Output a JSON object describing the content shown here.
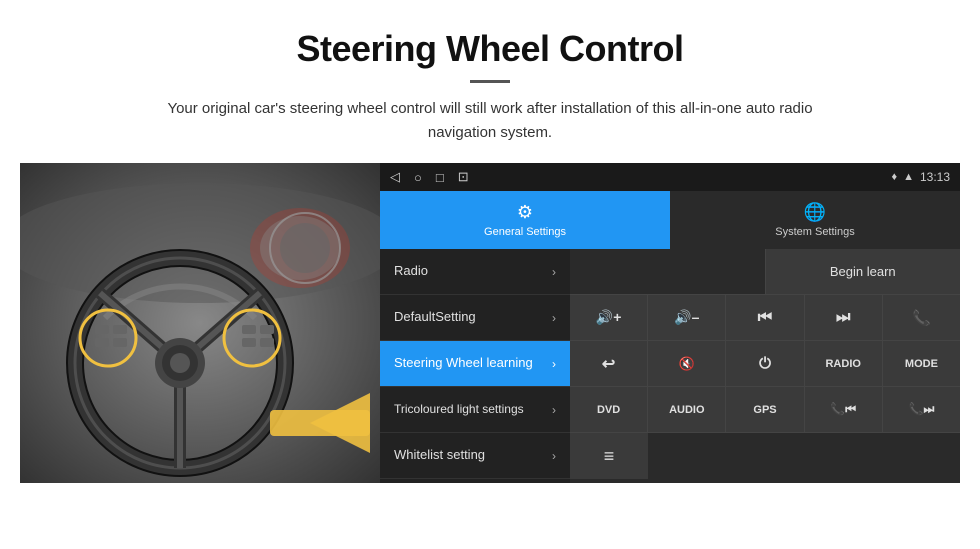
{
  "header": {
    "title": "Steering Wheel Control",
    "description": "Your original car's steering wheel control will still work after installation of this all-in-one auto radio navigation system."
  },
  "statusBar": {
    "time": "13:13",
    "icons": [
      "◁",
      "○",
      "□",
      "⊡"
    ]
  },
  "tabs": [
    {
      "id": "general",
      "label": "General Settings",
      "icon": "⚙",
      "active": true
    },
    {
      "id": "system",
      "label": "System Settings",
      "icon": "🌐",
      "active": false
    }
  ],
  "menuItems": [
    {
      "label": "Radio",
      "active": false
    },
    {
      "label": "DefaultSetting",
      "active": false
    },
    {
      "label": "Steering Wheel learning",
      "active": true
    },
    {
      "label": "Tricoloured light settings",
      "active": false
    },
    {
      "label": "Whitelist setting",
      "active": false
    }
  ],
  "controls": {
    "beginLearnLabel": "Begin learn",
    "rows": [
      [
        {
          "label": "🔊+",
          "type": "icon"
        },
        {
          "label": "🔊–",
          "type": "icon"
        },
        {
          "label": "⏮",
          "type": "icon"
        },
        {
          "label": "⏭",
          "type": "icon"
        },
        {
          "label": "📞",
          "type": "icon"
        }
      ],
      [
        {
          "label": "↩",
          "type": "icon"
        },
        {
          "label": "🔊✕",
          "type": "icon"
        },
        {
          "label": "⏻",
          "type": "icon"
        },
        {
          "label": "RADIO",
          "type": "text"
        },
        {
          "label": "MODE",
          "type": "text"
        }
      ],
      [
        {
          "label": "DVD",
          "type": "text"
        },
        {
          "label": "AUDIO",
          "type": "text"
        },
        {
          "label": "GPS",
          "type": "text"
        },
        {
          "label": "📞⏮",
          "type": "icon"
        },
        {
          "label": "📞⏭",
          "type": "icon"
        }
      ],
      [
        {
          "label": "≡",
          "type": "icon"
        }
      ]
    ]
  }
}
